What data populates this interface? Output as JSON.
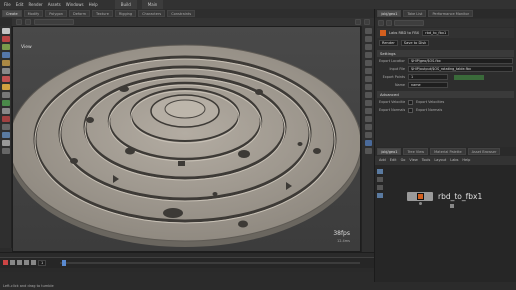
{
  "menu": {
    "items": [
      "File",
      "Edit",
      "Render",
      "Assets",
      "Windows",
      "Help"
    ],
    "build_label": "Build",
    "desktop_label": "Main"
  },
  "shelf_tabs": [
    "Create",
    "Modify",
    "Polygon",
    "Deform",
    "Texture",
    "Rigging",
    "Characters",
    "Constraints"
  ],
  "viewport": {
    "view_label": "View",
    "fps": "38fps",
    "fps_sub": "12.4ms"
  },
  "param_tabs": [
    "/obj/geo1",
    "Take List",
    "Performance Monitor"
  ],
  "param_header": {
    "node_type": "Labs RBD to FBX",
    "node_name": "rbd_to_fbx1"
  },
  "params": {
    "section_settings": "Settings",
    "rows": [
      {
        "label": "Export Location",
        "value": "$HIP/geo/$OS.fbx"
      },
      {
        "label": "Input File",
        "value": "$HIP/output/$OS_rotating_table.fbx"
      },
      {
        "label": "Export Points",
        "value": "1"
      },
      {
        "label": "Name",
        "value": "name"
      }
    ],
    "section_advanced": "Advanced",
    "check_rows": [
      {
        "label": "Export Velocities",
        "text": "Export Velocities"
      },
      {
        "label": "Export Normals",
        "text": "Export Normals"
      }
    ],
    "render_button": "Render",
    "save_button": "Save to Disk"
  },
  "net_tabs": [
    "/obj/geo1",
    "Tree View",
    "Material Palette",
    "Asset Browser"
  ],
  "net_bar": [
    "Add",
    "Edit",
    "Go",
    "View",
    "Tools",
    "Layout",
    "Labs",
    "Help"
  ],
  "node": {
    "label": "rbd_to_fbx1"
  },
  "statusbar": {
    "text": "Left-click and drag to tumble"
  },
  "playbar": {
    "frame": "1",
    "end_frame": "240"
  }
}
